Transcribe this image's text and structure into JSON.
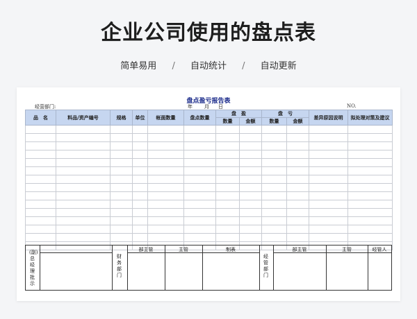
{
  "page": {
    "title": "企业公司使用的盘点表",
    "tags": [
      "简单易用",
      "自动统计",
      "自动更新"
    ],
    "separator": "/"
  },
  "report": {
    "title": "盘点盈亏报告表",
    "dept_label": "经营部门:",
    "year": "年",
    "month": "月",
    "day": "日",
    "no_label": "NO.",
    "headers": {
      "name": "品　名",
      "code": "料品/资产编号",
      "spec": "规格",
      "unit": "单位",
      "book_qty": "帐面数量",
      "count_qty": "盘点数量",
      "surplus": "盘　盈",
      "loss": "盘　亏",
      "qty": "数量",
      "amount": "金额",
      "reason": "差异原因说明",
      "measures": "拟处理对策及建议"
    },
    "sign": {
      "gm": "(副)总经理批示",
      "finance": "财务部门",
      "finance_cols": [
        "部主管",
        "主管",
        "制表"
      ],
      "ops": "经管部门",
      "ops_cols": [
        "部主管",
        "主管",
        "经管人"
      ]
    }
  }
}
